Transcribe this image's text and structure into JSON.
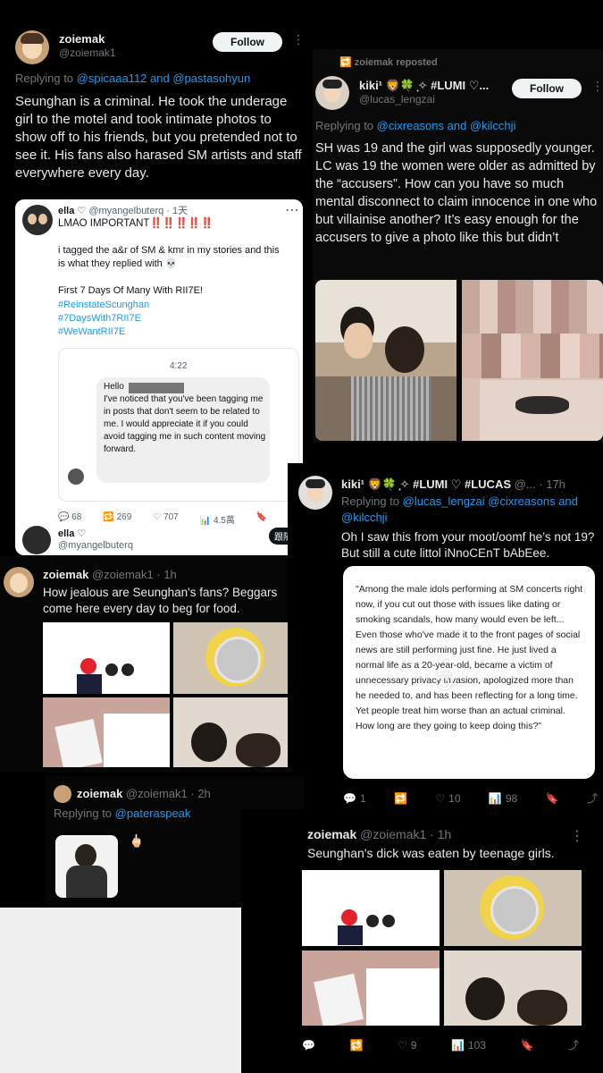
{
  "post1": {
    "name": "zoiemak",
    "handle": "@zoiemak1",
    "follow": "Follow",
    "reply_prefix": "Replying to",
    "reply_to": "@spicaaa112 and @pastasohyun",
    "text": "Seunghan is a criminal. He took the underage girl to the motel and took intimate photos to show off to his friends, but you pretended not to see it. His fans also harased SM artists and staff everywhere every day.",
    "embed": {
      "name": "ella ♡",
      "handle": "@myangelbuterq · 1天",
      "line1": "LMAO IMPORTANT‼️‼️‼️‼️‼️",
      "line2": "i tagged the a&r of SM & kmr in my stories and this is what they replied with 💀",
      "line3": "First 7 Days Of Many With RII7E!",
      "tags": [
        "#ReinstateScunghan",
        "#7DaysWith7RII7E",
        "#WeWantRII7E"
      ],
      "dm_time": "4:22",
      "dm_text": "Hello\nI've noticed that you've been tagging me in posts that don't seem to be related to me. I would appreciate it if you could avoid tagging me in such content moving forward.",
      "stats": [
        "269",
        "707",
        "4.5萬"
      ],
      "footer_name": "ella ♡",
      "footer_handle": "@myangelbuterq",
      "footer_btn": "跟隨"
    }
  },
  "post2": {
    "repost": "zoiemak reposted",
    "name": "kiki¹ 🦁🍀 ̟✧ #LUMI ♡...",
    "handle": "@lucas_lengzai",
    "follow": "Follow",
    "reply_prefix": "Replying to",
    "reply_to": "@cixreasons and @kilcchji",
    "text": "SH was 19 and the girl was supposedly younger. LC was 19 the women were older as admitted by the “accusers”.  How can you have so much mental disconnect to claim innocence in one who but villainise another? It’s easy enough for the accusers to give a photo like this but didn’t"
  },
  "post3": {
    "name": "zoiemak",
    "handle": "@zoiemak1 · 1h",
    "text": "How jealous are Seunghan's fans? Beggars come here every day to beg for food."
  },
  "post4": {
    "name": "kiki¹ 🦁🍀 ̟✧ #LUMI ♡ #LUCAS",
    "handle": "@... · 17h",
    "reply_prefix": "Replying to",
    "reply_to_1": "@lucas_lengzai @cixreasons and",
    "reply_to_2": "@kilcchji",
    "text": "Oh I saw this from your moot/oomf he’s not 19? But still a cute littol iNnoCEnT bAbEee.",
    "quote": "\"Among the male idols performing at SM concerts right now, if you cut out those with issues like dating or smoking scandals, how many would even be left... Even those who've made it to the front pages of social news are still performing just fine. He just lived a normal life as a 20-year-old, became a victim of unnecessary privacy invasion, apologized more than he needed to, and has been reflecting for a long time. Yet people treat him worse than an actual criminal. How long are they going to keep doing this?\"",
    "stats": {
      "replies": "1",
      "likes": "10",
      "views": "98"
    }
  },
  "post5": {
    "name": "zoiemak",
    "handle": "@zoiemak1 · 2h",
    "reply_prefix": "Replying to",
    "reply_to": "@pateraspeak",
    "emoji": "🖕🏻"
  },
  "post6": {
    "name": "zoiemak",
    "handle": "@zoiemak1 · 1h",
    "text": "Seunghan's dick was eaten by teenage girls.",
    "stats": {
      "likes": "9",
      "views": "103"
    }
  },
  "icons": [
    "more-icon",
    "retweet-icon",
    "reply-icon",
    "like-icon",
    "views-icon",
    "bookmark-icon",
    "share-icon"
  ]
}
